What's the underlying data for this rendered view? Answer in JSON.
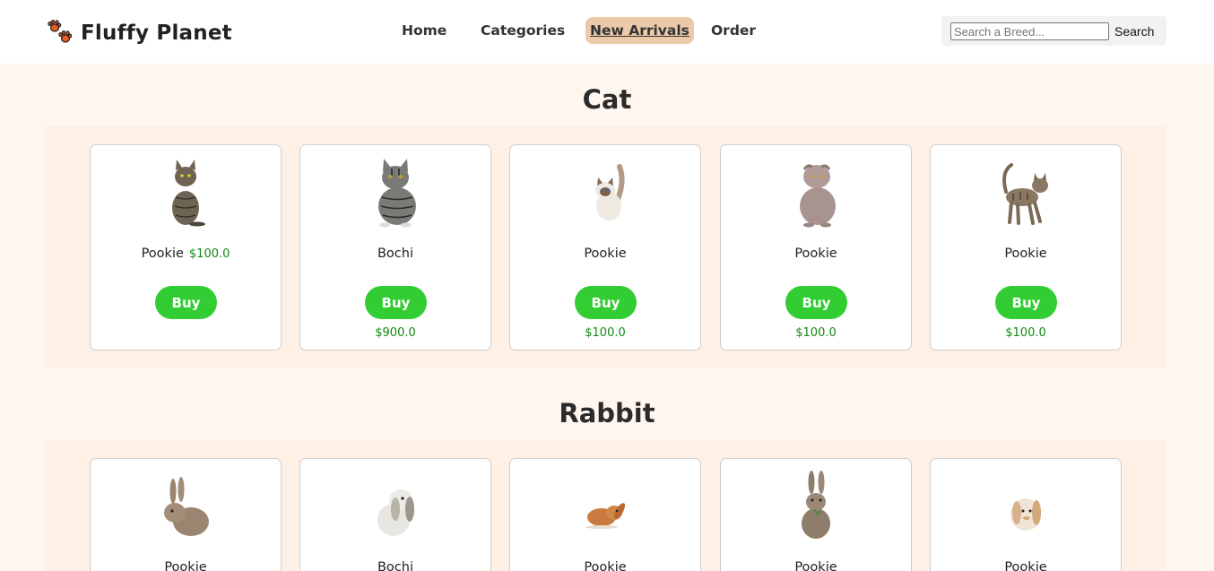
{
  "brand": {
    "name": "Fluffy Planet",
    "icon": "paw-icon"
  },
  "nav": {
    "home": "Home",
    "categories": "Categories",
    "new_arrivals": "New Arrivals",
    "order": "Order"
  },
  "search": {
    "placeholder": "Search a Breed...",
    "value": "",
    "button": "Search"
  },
  "colors": {
    "accent": "#32cd32",
    "price": "#138a13",
    "active_nav": "#ecc9a8",
    "band": "#fff0e6",
    "background": "#fff6ef"
  },
  "sections": [
    {
      "title": "Cat",
      "pets": [
        {
          "name": "Pookie",
          "inline_price": "$100.0",
          "buy": "Buy",
          "price": "",
          "image": "cat-image"
        },
        {
          "name": "Bochi",
          "buy": "Buy",
          "price": "$900.0",
          "image": "cat-image"
        },
        {
          "name": "Pookie",
          "buy": "Buy",
          "price": "$100.0",
          "image": "cat-image"
        },
        {
          "name": "Pookie",
          "buy": "Buy",
          "price": "$100.0",
          "image": "cat-image"
        },
        {
          "name": "Pookie",
          "buy": "Buy",
          "price": "$100.0",
          "image": "cat-image"
        }
      ]
    },
    {
      "title": "Rabbit",
      "pets": [
        {
          "name": "Pookie",
          "image": "rabbit-image"
        },
        {
          "name": "Bochi",
          "image": "rabbit-image"
        },
        {
          "name": "Pookie",
          "image": "rabbit-image"
        },
        {
          "name": "Pookie",
          "image": "rabbit-image"
        },
        {
          "name": "Pookie",
          "image": "rabbit-image"
        }
      ]
    }
  ]
}
